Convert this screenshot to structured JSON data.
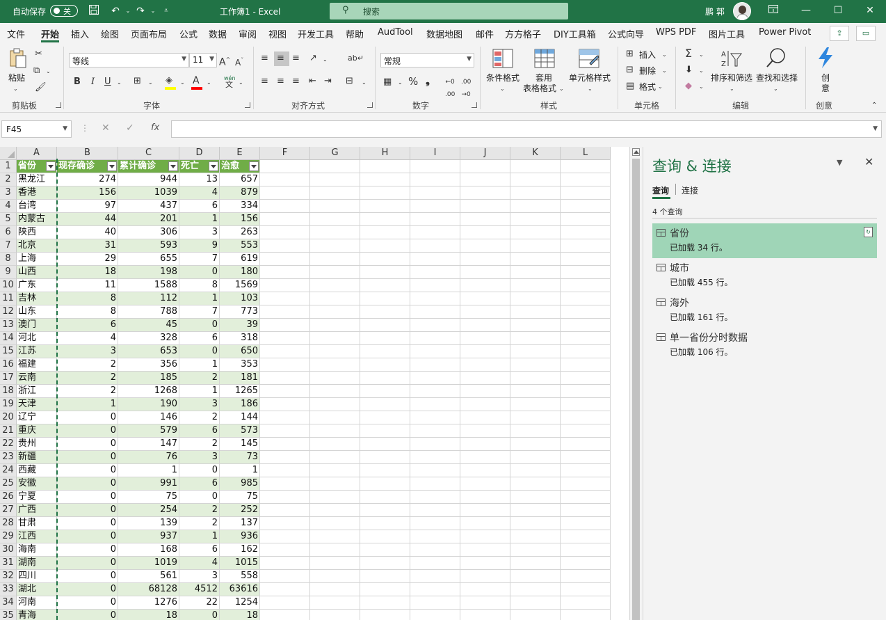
{
  "titlebar": {
    "autosave_label": "自动保存",
    "autosave_state": "关",
    "doc_title": "工作簿1  -  Excel",
    "search_placeholder": "搜索",
    "user_name": "鹏 郭"
  },
  "menu": {
    "tabs": [
      "文件",
      "开始",
      "插入",
      "绘图",
      "页面布局",
      "公式",
      "数据",
      "审阅",
      "视图",
      "开发工具",
      "帮助",
      "AudTool",
      "数据地图",
      "邮件",
      "方方格子",
      "DIY工具箱",
      "公式向导",
      "WPS PDF",
      "图片工具",
      "Power Pivot"
    ],
    "active": "开始"
  },
  "ribbon": {
    "clipboard": {
      "paste": "粘贴",
      "group": "剪贴板"
    },
    "font": {
      "name": "等线",
      "size": "11",
      "bold": "B",
      "italic": "I",
      "underline": "U",
      "group": "字体",
      "phonetic": "wén"
    },
    "alignment": {
      "group": "对齐方式"
    },
    "number": {
      "format": "常规",
      "group": "数字"
    },
    "styles": {
      "conditional": "条件格式",
      "table_fmt_1": "套用",
      "table_fmt_2": "表格格式",
      "cell_styles": "单元格样式",
      "group": "样式"
    },
    "cells": {
      "insert": "插入",
      "delete": "删除",
      "format": "格式",
      "group": "单元格"
    },
    "editing": {
      "sort_filter": "排序和筛选",
      "find_select": "查找和选择",
      "group": "编辑"
    },
    "creativity": {
      "label_1": "创",
      "label_2": "意",
      "group": "创意"
    }
  },
  "formula_bar": {
    "name_box": "F45",
    "formula": ""
  },
  "grid": {
    "columns": [
      "A",
      "B",
      "C",
      "D",
      "E",
      "F",
      "G",
      "H",
      "I",
      "J",
      "K",
      "L"
    ],
    "header": [
      "省份",
      "现存确诊",
      "累计确诊",
      "死亡",
      "治愈"
    ],
    "rows": [
      [
        "黑龙江",
        274,
        944,
        13,
        657
      ],
      [
        "香港",
        156,
        1039,
        4,
        879
      ],
      [
        "台湾",
        97,
        437,
        6,
        334
      ],
      [
        "内蒙古",
        44,
        201,
        1,
        156
      ],
      [
        "陕西",
        40,
        306,
        3,
        263
      ],
      [
        "北京",
        31,
        593,
        9,
        553
      ],
      [
        "上海",
        29,
        655,
        7,
        619
      ],
      [
        "山西",
        18,
        198,
        0,
        180
      ],
      [
        "广东",
        11,
        1588,
        8,
        1569
      ],
      [
        "吉林",
        8,
        112,
        1,
        103
      ],
      [
        "山东",
        8,
        788,
        7,
        773
      ],
      [
        "澳门",
        6,
        45,
        0,
        39
      ],
      [
        "河北",
        4,
        328,
        6,
        318
      ],
      [
        "江苏",
        3,
        653,
        0,
        650
      ],
      [
        "福建",
        2,
        356,
        1,
        353
      ],
      [
        "云南",
        2,
        185,
        2,
        181
      ],
      [
        "浙江",
        2,
        1268,
        1,
        1265
      ],
      [
        "天津",
        1,
        190,
        3,
        186
      ],
      [
        "辽宁",
        0,
        146,
        2,
        144
      ],
      [
        "重庆",
        0,
        579,
        6,
        573
      ],
      [
        "贵州",
        0,
        147,
        2,
        145
      ],
      [
        "新疆",
        0,
        76,
        3,
        73
      ],
      [
        "西藏",
        0,
        1,
        0,
        1
      ],
      [
        "安徽",
        0,
        991,
        6,
        985
      ],
      [
        "宁夏",
        0,
        75,
        0,
        75
      ],
      [
        "广西",
        0,
        254,
        2,
        252
      ],
      [
        "甘肃",
        0,
        139,
        2,
        137
      ],
      [
        "江西",
        0,
        937,
        1,
        936
      ],
      [
        "海南",
        0,
        168,
        6,
        162
      ],
      [
        "湖南",
        0,
        1019,
        4,
        1015
      ],
      [
        "四川",
        0,
        561,
        3,
        558
      ],
      [
        "湖北",
        0,
        68128,
        4512,
        63616
      ],
      [
        "河南",
        0,
        1276,
        22,
        1254
      ],
      [
        "青海",
        0,
        18,
        0,
        18
      ]
    ]
  },
  "query_pane": {
    "title": "查询 & 连接",
    "tab_queries": "查询",
    "tab_connections": "连接",
    "count_label": "4 个查询",
    "items": [
      {
        "name": "省份",
        "status": "已加载 34 行。"
      },
      {
        "name": "城市",
        "status": "已加载 455 行。"
      },
      {
        "name": "海外",
        "status": "已加载 161 行。"
      },
      {
        "name": "单一省份分时数据",
        "status": "已加载 106 行。"
      }
    ]
  },
  "colors": {
    "brand": "#217346",
    "table_header": "#70ad47",
    "table_band": "#e2efda",
    "query_selected": "#9fd5b7"
  }
}
